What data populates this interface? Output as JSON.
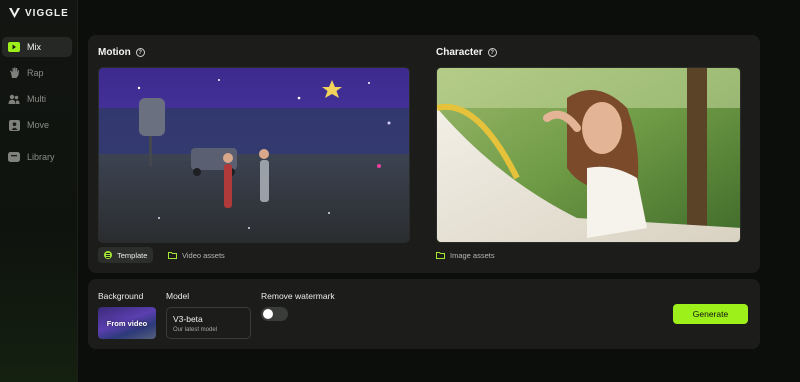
{
  "app": {
    "name": "VIGGLE"
  },
  "sidebar": {
    "items": [
      {
        "label": "Mix",
        "icon": "play-icon",
        "active": true
      },
      {
        "label": "Rap",
        "icon": "hand-icon",
        "active": false
      },
      {
        "label": "Multi",
        "icon": "people-icon",
        "active": false
      },
      {
        "label": "Move",
        "icon": "image-icon",
        "active": false
      },
      {
        "label": "Library",
        "icon": "library-icon",
        "active": false
      }
    ]
  },
  "motion": {
    "title": "Motion",
    "tabs": {
      "template": "Template",
      "video_assets": "Video assets"
    }
  },
  "character": {
    "title": "Character",
    "image_assets": "Image assets"
  },
  "settings": {
    "background_label": "Background",
    "background_value": "From video",
    "model_label": "Model",
    "model_name": "V3-beta",
    "model_sub": "Our latest model",
    "watermark_label": "Remove watermark",
    "watermark_on": false
  },
  "generate_label": "Generate",
  "colors": {
    "accent": "#9ef01a",
    "panel": "#1c1d1b",
    "background": "#0d0f0c"
  }
}
